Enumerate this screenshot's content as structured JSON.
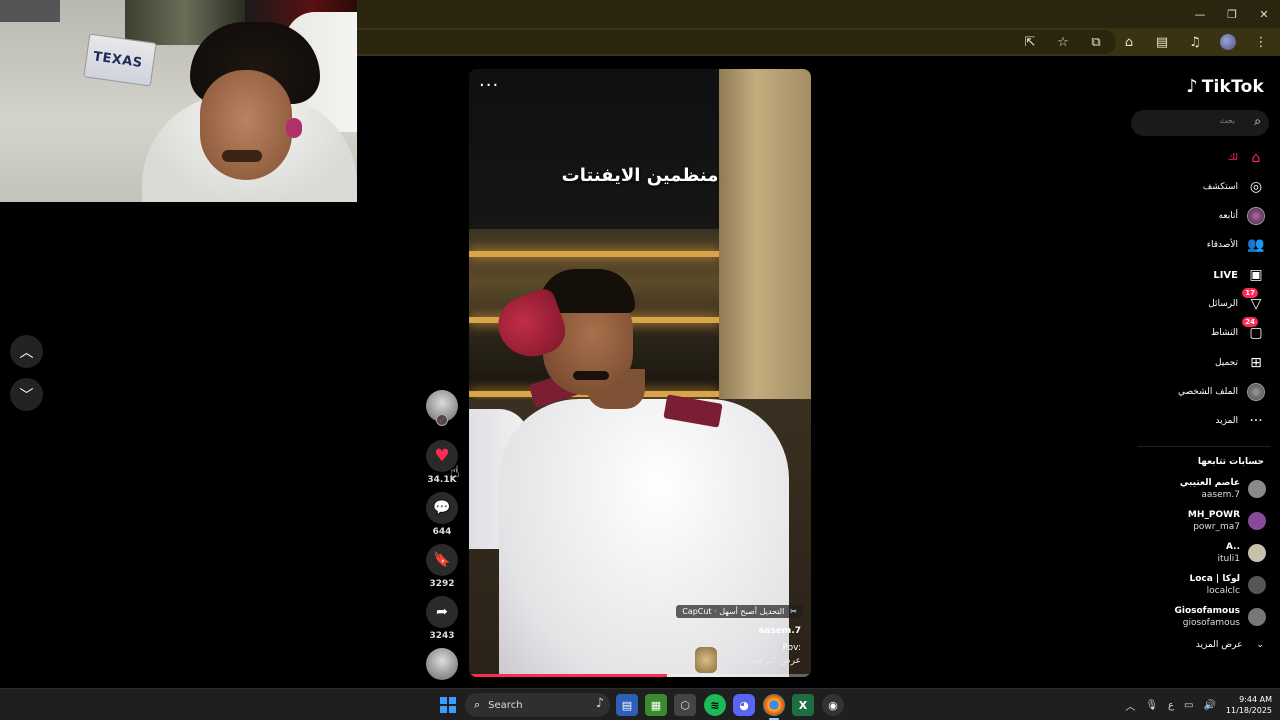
{
  "browser": {
    "window_controls": [
      "minimize",
      "maximize",
      "close"
    ],
    "toolbar_icons": [
      "cast-icon",
      "star-icon",
      "extensions-icon",
      "chromecast-icon",
      "sidepanel-icon",
      "media-icon",
      "profile-icon",
      "kebab-menu-icon"
    ]
  },
  "webcam": {
    "plate_text": "TEXAS"
  },
  "video": {
    "title": "منظمين الايفنتات",
    "capcut_badge": "CapCut · التحديل أصبح أسهل",
    "author": "aasem.7",
    "description": "Pov:",
    "translate": "عرض الترجمة",
    "progress": 0.58,
    "more_glyph": "···"
  },
  "actions": {
    "likes": "34.1K",
    "comments": "644",
    "saves": "3292",
    "shares": "3243"
  },
  "sidebar": {
    "logo": "TikTok",
    "search_placeholder": "بحث",
    "nav": [
      {
        "label": "لك",
        "icon": "home-icon"
      },
      {
        "label": "استكشف",
        "icon": "compass-icon"
      },
      {
        "label": "أتابعه",
        "icon": "following-avatar-icon"
      },
      {
        "label": "الأصدقاء",
        "icon": "friends-icon"
      },
      {
        "label": "LIVE",
        "icon": "live-icon"
      },
      {
        "label": "الرسائل",
        "icon": "messages-icon",
        "badge": "17"
      },
      {
        "label": "النشاط",
        "icon": "activity-icon",
        "badge": "24"
      },
      {
        "label": "تحميل",
        "icon": "upload-icon"
      },
      {
        "label": "الملف الشخصي",
        "icon": "profile-avatar-icon"
      },
      {
        "label": "المزيد",
        "icon": "more-icon"
      }
    ],
    "following_title": "حسابات تتابعها",
    "following": [
      {
        "name": "عاصم العتيبي",
        "handle": "aasem.7",
        "color": "#8a8a8a"
      },
      {
        "name": "MH_POWR",
        "handle": "powr_ma7",
        "color": "#8a4a9a"
      },
      {
        "name": "A..",
        "handle": "ituli1",
        "color": "#c8c0a8"
      },
      {
        "name": "Loca | لوكا",
        "handle": "localclc",
        "color": "#555555"
      },
      {
        "name": "Giosofamous",
        "handle": "giosofamous",
        "color": "#777777"
      }
    ],
    "show_more": "عرض المزيد"
  },
  "taskbar": {
    "search_label": "Search",
    "time": "9:44 AM",
    "date": "11/18/2025",
    "ime": "ع",
    "apps": [
      "files-app",
      "minecraft-app",
      "settings-app",
      "spotify-app",
      "discord-app",
      "chrome-app",
      "excel-app",
      "recorder-app"
    ]
  },
  "colors": {
    "accent": "#fe2c55",
    "chrome": "#3a3312"
  }
}
